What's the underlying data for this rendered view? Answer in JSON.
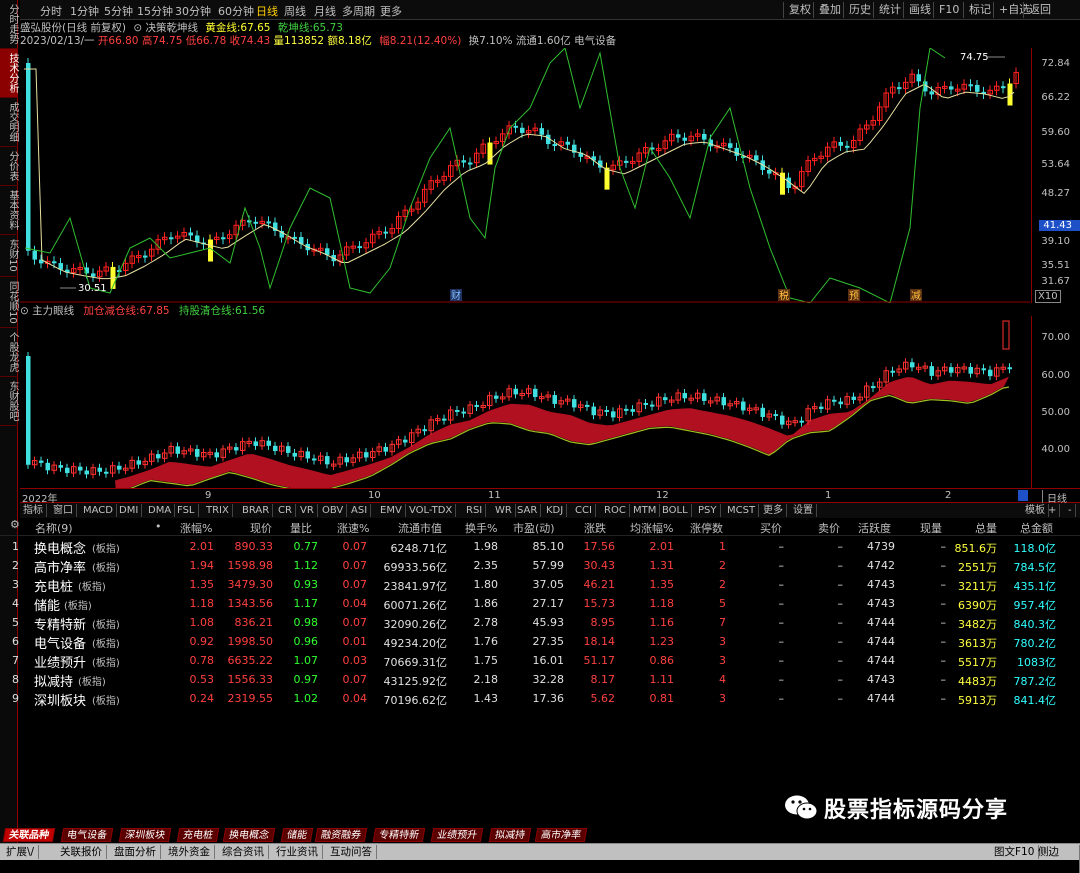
{
  "left_tabs": [
    {
      "label": "分时走势",
      "active": false
    },
    {
      "label": "技术分析",
      "active": true
    },
    {
      "label": "成交明细",
      "active": false
    },
    {
      "label": "分价表",
      "active": false
    },
    {
      "label": "基本资料",
      "active": false
    },
    {
      "label": "东财10",
      "active": false
    },
    {
      "label": "同花顺10",
      "active": false
    },
    {
      "label": "个股龙虎",
      "active": false
    },
    {
      "label": "东财股吧",
      "active": false
    }
  ],
  "top_periods": [
    {
      "label": "分时",
      "active": false
    },
    {
      "label": "1分钟",
      "active": false
    },
    {
      "label": "5分钟",
      "active": false
    },
    {
      "label": "15分钟",
      "active": false
    },
    {
      "label": "30分钟",
      "active": false
    },
    {
      "label": "60分钟",
      "active": false
    },
    {
      "label": "日线",
      "active": true
    },
    {
      "label": "周线",
      "active": false
    },
    {
      "label": "月线",
      "active": false
    },
    {
      "label": "多周期",
      "active": false
    },
    {
      "label": "更多",
      "active": false
    }
  ],
  "top_right": [
    "复权",
    "叠加",
    "历史",
    "统计",
    "画线",
    "F10",
    "标记",
    "+自选",
    "返回"
  ],
  "title": {
    "stock": "盛弘股份(日线 前复权)",
    "indicator": "决策乾坤线",
    "gold_label": "黄金线:",
    "gold_value": "67.65",
    "qk_label": "乾坤线:",
    "qk_value": "65.73"
  },
  "info": {
    "date": "2023/02/13/一",
    "open": "开66.80",
    "high": "高74.75",
    "low": "低66.78",
    "close": "收74.43",
    "vol": "量113852",
    "amount": "额8.18亿",
    "change": "幅8.21(12.40%)",
    "turnover": "换7.10%",
    "float": "流通1.60亿",
    "sector": "电气设备"
  },
  "main_axis": [
    "72.84",
    "66.22",
    "59.60",
    "53.64",
    "48.27",
    "41.43",
    "39.10",
    "35.51",
    "31.67"
  ],
  "main_axis_highlight": "41.43",
  "main_axis_unit": "X10",
  "main_labels": {
    "high": "74.75",
    "low": "30.51"
  },
  "markers": [
    "财",
    "税",
    "预",
    "减"
  ],
  "sub_title": {
    "name": "主力眼线",
    "add_label": "加仓减仓线:",
    "add_value": "67.85",
    "hold_label": "持股清仓线:",
    "hold_value": "61.56"
  },
  "sub_axis": [
    "70.00",
    "60.00",
    "50.00",
    "40.00"
  ],
  "date_axis": [
    "2022年",
    "9",
    "10",
    "11",
    "12",
    "1",
    "2"
  ],
  "date_axis_right": "日线",
  "indicator_tabs": [
    "指标",
    "窗口",
    "MACD",
    "DMI",
    "DMA",
    "FSL",
    "TRIX",
    "BRAR",
    "CR",
    "VR",
    "OBV",
    "ASI",
    "EMV",
    "VOL-TDX",
    "RSI",
    "WR",
    "SAR",
    "KDJ",
    "CCI",
    "ROC",
    "MTM",
    "BOLL",
    "PSY",
    "MCST",
    "更多",
    "设置"
  ],
  "indicator_tabs_right": [
    "模板",
    "+",
    "-"
  ],
  "table": {
    "headers": [
      "名称(9)",
      "•",
      "涨幅%",
      "现价",
      "量比",
      "涨速%",
      "流通市值",
      "换手%",
      "市盈(动)",
      "涨跌",
      "均涨幅%",
      "涨停数",
      "买价",
      "卖价",
      "活跃度",
      "现量",
      "总量",
      "总金额"
    ],
    "rows": [
      {
        "idx": "1",
        "name": "换电概念",
        "tag": "(板指)",
        "chg": "2.01",
        "price": "890.33",
        "vr": "0.77",
        "speed": "0.07",
        "mcap": "6248.71亿",
        "turn": "1.98",
        "pe": "85.10",
        "diff": "17.56",
        "avg": "2.01",
        "lim": "1",
        "bid": "–",
        "ask": "–",
        "act": "4739",
        "cur": "–",
        "vol": "851.6万",
        "amt": "118.0亿"
      },
      {
        "idx": "2",
        "name": "高市净率",
        "tag": "(板指)",
        "chg": "1.94",
        "price": "1598.98",
        "vr": "1.12",
        "speed": "0.07",
        "mcap": "69933.56亿",
        "turn": "2.35",
        "pe": "57.99",
        "diff": "30.43",
        "avg": "1.31",
        "lim": "2",
        "bid": "–",
        "ask": "–",
        "act": "4742",
        "cur": "–",
        "vol": "2551万",
        "amt": "784.5亿"
      },
      {
        "idx": "3",
        "name": "充电桩",
        "tag": "(板指)",
        "chg": "1.35",
        "price": "3479.30",
        "vr": "0.93",
        "speed": "0.07",
        "mcap": "23841.97亿",
        "turn": "1.80",
        "pe": "37.05",
        "diff": "46.21",
        "avg": "1.35",
        "lim": "2",
        "bid": "–",
        "ask": "–",
        "act": "4743",
        "cur": "–",
        "vol": "3211万",
        "amt": "435.1亿"
      },
      {
        "idx": "4",
        "name": "储能",
        "tag": "(板指)",
        "chg": "1.18",
        "price": "1343.56",
        "vr": "1.17",
        "speed": "0.04",
        "mcap": "60071.26亿",
        "turn": "1.86",
        "pe": "27.17",
        "diff": "15.73",
        "avg": "1.18",
        "lim": "5",
        "bid": "–",
        "ask": "–",
        "act": "4743",
        "cur": "–",
        "vol": "6390万",
        "amt": "957.4亿"
      },
      {
        "idx": "5",
        "name": "专精特新",
        "tag": "(板指)",
        "chg": "1.08",
        "price": "836.21",
        "vr": "0.98",
        "speed": "0.07",
        "mcap": "32090.26亿",
        "turn": "2.78",
        "pe": "45.93",
        "diff": "8.95",
        "avg": "1.16",
        "lim": "7",
        "bid": "–",
        "ask": "–",
        "act": "4744",
        "cur": "–",
        "vol": "3482万",
        "amt": "840.3亿"
      },
      {
        "idx": "6",
        "name": "电气设备",
        "tag": "(板指)",
        "chg": "0.92",
        "price": "1998.50",
        "vr": "0.96",
        "speed": "0.01",
        "mcap": "49234.20亿",
        "turn": "1.76",
        "pe": "27.35",
        "diff": "18.14",
        "avg": "1.23",
        "lim": "3",
        "bid": "–",
        "ask": "–",
        "act": "4744",
        "cur": "–",
        "vol": "3613万",
        "amt": "780.2亿"
      },
      {
        "idx": "7",
        "name": "业绩预升",
        "tag": "(板指)",
        "chg": "0.78",
        "price": "6635.22",
        "vr": "1.07",
        "speed": "0.03",
        "mcap": "70669.31亿",
        "turn": "1.75",
        "pe": "16.01",
        "diff": "51.17",
        "avg": "0.86",
        "lim": "3",
        "bid": "–",
        "ask": "–",
        "act": "4744",
        "cur": "–",
        "vol": "5517万",
        "amt": "1083亿"
      },
      {
        "idx": "8",
        "name": "拟减持",
        "tag": "(板指)",
        "chg": "0.53",
        "price": "1556.33",
        "vr": "0.97",
        "speed": "0.07",
        "mcap": "43125.92亿",
        "turn": "2.18",
        "pe": "32.28",
        "diff": "8.17",
        "avg": "1.11",
        "lim": "4",
        "bid": "–",
        "ask": "–",
        "act": "4743",
        "cur": "–",
        "vol": "4483万",
        "amt": "787.2亿"
      },
      {
        "idx": "9",
        "name": "深圳板块",
        "tag": "(板指)",
        "chg": "0.24",
        "price": "2319.55",
        "vr": "1.02",
        "speed": "0.04",
        "mcap": "70196.62亿",
        "turn": "1.43",
        "pe": "17.36",
        "diff": "5.62",
        "avg": "0.81",
        "lim": "3",
        "bid": "–",
        "ask": "–",
        "act": "4744",
        "cur": "–",
        "vol": "5913万",
        "amt": "841.4亿"
      }
    ]
  },
  "watermark": "股票指标源码分享",
  "bottom_tabs": [
    {
      "label": "关联品种",
      "active": true
    },
    {
      "label": "电气设备",
      "active": false
    },
    {
      "label": "深圳板块",
      "active": false
    },
    {
      "label": "充电桩",
      "active": false
    },
    {
      "label": "换电概念",
      "active": false
    },
    {
      "label": "储能",
      "active": false
    },
    {
      "label": "融资融券",
      "active": false
    },
    {
      "label": "专精特新",
      "active": false
    },
    {
      "label": "业绩预升",
      "active": false
    },
    {
      "label": "拟减持",
      "active": false
    },
    {
      "label": "高市净率",
      "active": false
    }
  ],
  "status_bar": [
    "扩展\\/",
    "关联报价",
    "盘面分析",
    "境外资金",
    "综合资讯",
    "行业资讯",
    "互动问答"
  ],
  "status_right": [
    "图文F10",
    "侧边栏»"
  ],
  "colors": {
    "up": "#ff2020",
    "down": "#40e0e0",
    "gold": "#ffff30",
    "qk_line": "#40d040",
    "accent": "#8b0000"
  }
}
